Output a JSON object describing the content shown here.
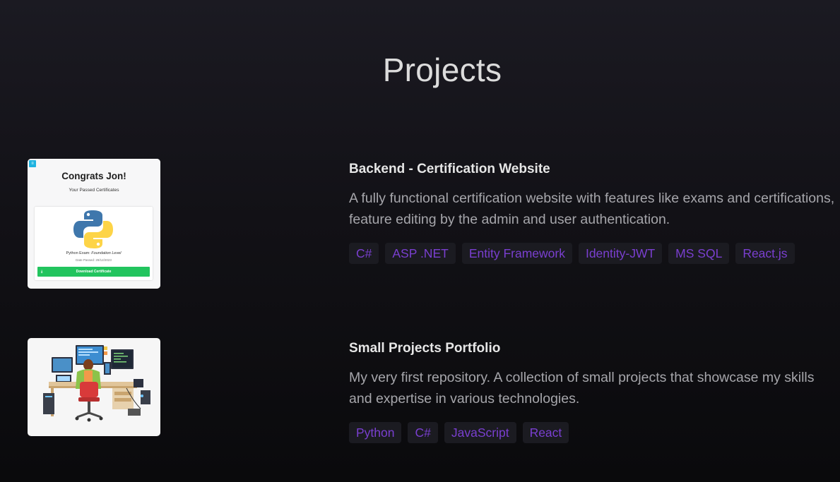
{
  "section": {
    "title": "Projects"
  },
  "projects": [
    {
      "title": "Backend - Certification Website",
      "description": "A fully functional certification website with features like exams and certifications, feature editing by the admin and user authentication.",
      "tags": [
        "C#",
        "ASP .NET",
        "Entity Framework",
        "Identity-JWT",
        "MS SQL",
        "React.js"
      ],
      "thumbnail": {
        "corner_icon": "menu-icon",
        "heading": "Congrats Jon!",
        "subheading": "Your Passed Certificates",
        "exam_prefix": "Python Exam: ",
        "exam_level": "Foundation Level",
        "date_line": "Date Passed: 29/12/2023",
        "download_label": "Download Certificate",
        "logo": "python-logo"
      }
    },
    {
      "title": "Small Projects Portfolio",
      "description": "My very first repository. A collection of small projects that showcase my skills and expertise in various technologies.",
      "tags": [
        "Python",
        "C#",
        "JavaScript",
        "React"
      ],
      "thumbnail": {
        "illustration": "developer-workstation-illustration"
      }
    }
  ],
  "colors": {
    "tag_text": "#7a3fd0",
    "tag_bg": "#1b1b21",
    "title": "#e6e6e6",
    "description": "#a6a6ab",
    "download_button": "#22c45e"
  }
}
